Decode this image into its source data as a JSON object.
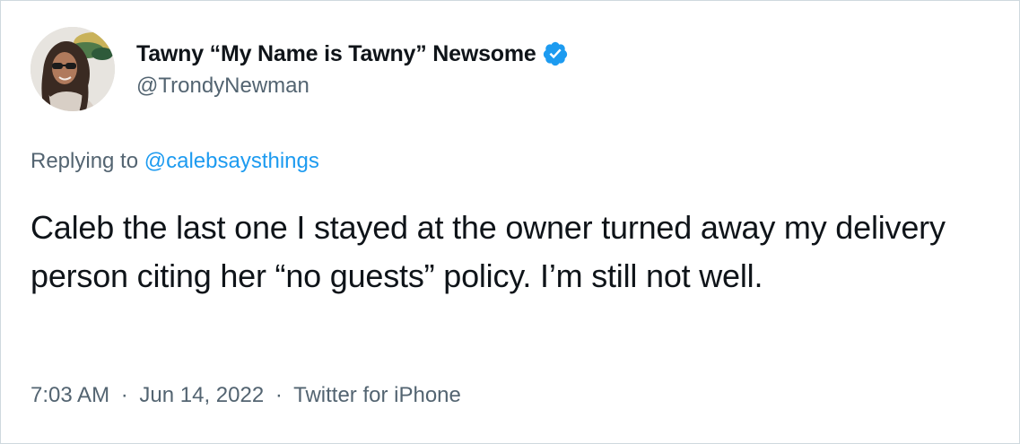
{
  "author": {
    "display_name": "Tawny “My Name is Tawny” Newsome",
    "handle": "@TrondyNewman",
    "verified_badge_icon": "verified-badge-icon",
    "avatar_icon": "profile-avatar"
  },
  "reply": {
    "prefix": "Replying to",
    "mention": "@calebsaysthings"
  },
  "tweet": {
    "text": "Caleb the last one I stayed at the owner turned away my delivery person citing her “no guests” policy. I’m still not well."
  },
  "meta": {
    "time": "7:03 AM",
    "separator": "·",
    "date": "Jun 14, 2022",
    "source": "Twitter for iPhone"
  },
  "colors": {
    "text_primary": "#0f1419",
    "text_secondary": "#536471",
    "link": "#1d9bf0",
    "border": "#cfd9de",
    "verified_blue": "#1d9bf0"
  }
}
